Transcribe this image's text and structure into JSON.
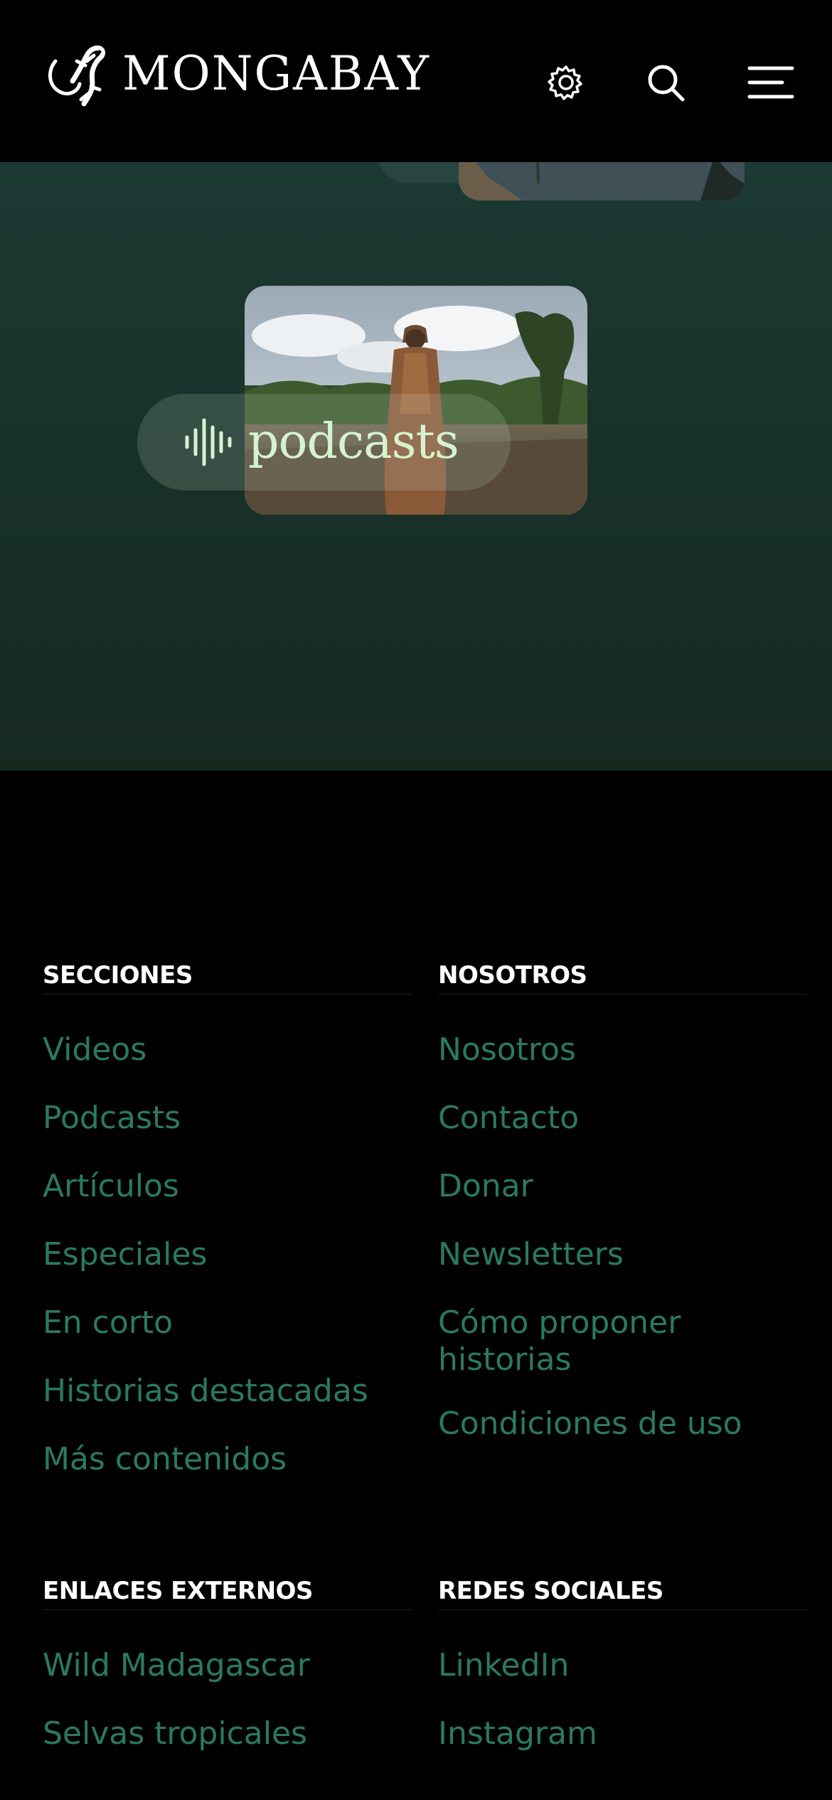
{
  "header": {
    "brand": "MONGABAY",
    "icons": {
      "logo": "gecko-logo-icon",
      "settings": "gear-icon",
      "search": "search-icon",
      "menu": "hamburger-menu-icon"
    }
  },
  "hero": {
    "podcast_label": "podcasts",
    "podcast_icon": "sound-wave-icon",
    "accent": "#d6f3cf",
    "background": "#1b3a33"
  },
  "footer": {
    "link_color": "#2a7a60",
    "secciones": {
      "title": "SECCIONES",
      "links": [
        "Videos",
        "Podcasts",
        "Artículos",
        "Especiales",
        "En corto",
        "Historias destacadas",
        "Más contenidos"
      ]
    },
    "nosotros": {
      "title": "NOSOTROS",
      "links": [
        "Nosotros",
        "Contacto",
        "Donar",
        "Newsletters",
        "Cómo proponer historias",
        "Condiciones de uso"
      ]
    },
    "enlaces": {
      "title": "ENLACES EXTERNOS",
      "links": [
        "Wild Madagascar",
        "Selvas tropicales"
      ]
    },
    "redes": {
      "title": "REDES SOCIALES",
      "links": [
        "LinkedIn",
        "Instagram"
      ]
    }
  }
}
